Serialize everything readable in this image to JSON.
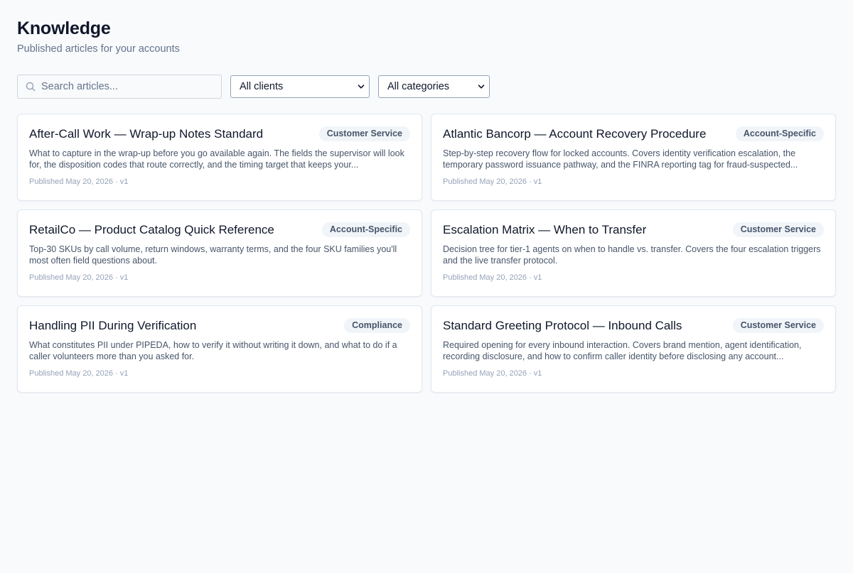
{
  "header": {
    "title": "Knowledge",
    "subtitle": "Published articles for your accounts"
  },
  "filters": {
    "search_placeholder": "Search articles...",
    "client_select": "All clients",
    "category_select": "All categories"
  },
  "articles": [
    {
      "title": "After-Call Work — Wrap-up Notes Standard",
      "category": "Customer Service",
      "description": "What to capture in the wrap-up before you go available again. The fields the supervisor will look for, the disposition codes that route correctly, and the timing target that keeps your...",
      "meta": "Published May 20, 2026 · v1"
    },
    {
      "title": "Atlantic Bancorp — Account Recovery Procedure",
      "category": "Account-Specific",
      "description": "Step-by-step recovery flow for locked accounts. Covers identity verification escalation, the temporary password issuance pathway, and the FINRA reporting tag for fraud-suspected...",
      "meta": "Published May 20, 2026 · v1"
    },
    {
      "title": "RetailCo — Product Catalog Quick Reference",
      "category": "Account-Specific",
      "description": "Top-30 SKUs by call volume, return windows, warranty terms, and the four SKU families you'll most often field questions about.",
      "meta": "Published May 20, 2026 · v1"
    },
    {
      "title": "Escalation Matrix — When to Transfer",
      "category": "Customer Service",
      "description": "Decision tree for tier-1 agents on when to handle vs. transfer. Covers the four escalation triggers and the live transfer protocol.",
      "meta": "Published May 20, 2026 · v1"
    },
    {
      "title": "Handling PII During Verification",
      "category": "Compliance",
      "description": "What constitutes PII under PIPEDA, how to verify it without writing it down, and what to do if a caller volunteers more than you asked for.",
      "meta": "Published May 20, 2026 · v1"
    },
    {
      "title": "Standard Greeting Protocol — Inbound Calls",
      "category": "Customer Service",
      "description": "Required opening for every inbound interaction. Covers brand mention, agent identification, recording disclosure, and how to confirm caller identity before disclosing any account...",
      "meta": "Published May 20, 2026 · v1"
    }
  ]
}
